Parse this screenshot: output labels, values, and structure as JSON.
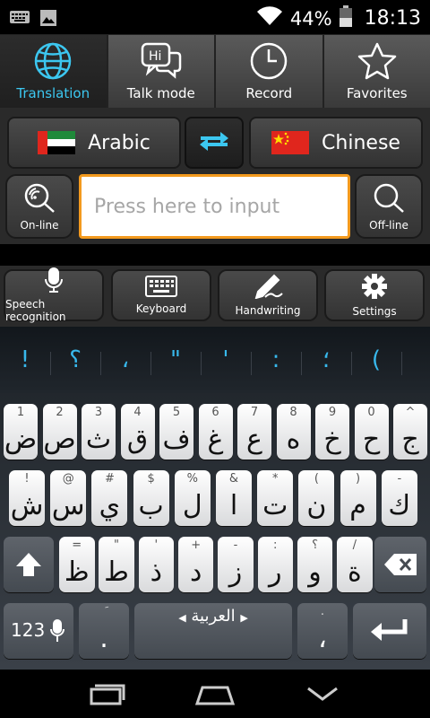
{
  "status_bar": {
    "battery": "44%",
    "time": "18:13",
    "icons": [
      "keyboard-icon",
      "image-icon",
      "wifi-icon",
      "battery-icon"
    ]
  },
  "tabs": [
    {
      "label": "Translation",
      "icon": "globe-icon",
      "active": true
    },
    {
      "label": "Talk mode",
      "icon": "chat-hi-icon",
      "bubble_text": "Hi",
      "active": false
    },
    {
      "label": "Record",
      "icon": "clock-icon",
      "active": false
    },
    {
      "label": "Favorites",
      "icon": "star-icon",
      "active": false
    }
  ],
  "languages": {
    "source": "Arabic",
    "target": "Chinese"
  },
  "search": {
    "online_label": "On-line",
    "offline_label": "Off-line",
    "placeholder": "Press here to input",
    "value": ""
  },
  "tools": [
    {
      "label": "Speech recognition",
      "icon": "microphone-icon"
    },
    {
      "label": "Keyboard",
      "icon": "keyboard-icon"
    },
    {
      "label": "Handwriting",
      "icon": "pen-icon"
    },
    {
      "label": "Settings",
      "icon": "gear-icon"
    }
  ],
  "suggestions": [
    "!",
    "؟",
    "،",
    "\"",
    "'",
    ":",
    "؛",
    "("
  ],
  "keyboard": {
    "row1": [
      {
        "main": "ض",
        "hint": "1"
      },
      {
        "main": "ص",
        "hint": "2"
      },
      {
        "main": "ث",
        "hint": "3"
      },
      {
        "main": "ق",
        "hint": "4"
      },
      {
        "main": "ف",
        "hint": "5"
      },
      {
        "main": "غ",
        "hint": "6"
      },
      {
        "main": "ع",
        "hint": "7"
      },
      {
        "main": "ه",
        "hint": "8"
      },
      {
        "main": "خ",
        "hint": "9"
      },
      {
        "main": "ح",
        "hint": "0"
      },
      {
        "main": "ج",
        "hint": "^"
      }
    ],
    "row2": [
      {
        "main": "ش",
        "hint": "!"
      },
      {
        "main": "س",
        "hint": "@"
      },
      {
        "main": "ي",
        "hint": "#"
      },
      {
        "main": "ب",
        "hint": "$"
      },
      {
        "main": "ل",
        "hint": "%"
      },
      {
        "main": "ا",
        "hint": "&"
      },
      {
        "main": "ت",
        "hint": "*"
      },
      {
        "main": "ن",
        "hint": "("
      },
      {
        "main": "م",
        "hint": ")"
      },
      {
        "main": "ك",
        "hint": "-"
      }
    ],
    "row3": [
      {
        "main": "ظ",
        "hint": "="
      },
      {
        "main": "ط",
        "hint": "\""
      },
      {
        "main": "ذ",
        "hint": "'"
      },
      {
        "main": "د",
        "hint": "+"
      },
      {
        "main": "ز",
        "hint": "-"
      },
      {
        "main": "ر",
        "hint": ":"
      },
      {
        "main": "و",
        "hint": "؟"
      },
      {
        "main": "ة",
        "hint": "/"
      }
    ],
    "numbers_key": "123",
    "period_key": ".",
    "period_hint": "َ",
    "space_label": "العربية",
    "comma_key": "،",
    "comma_hint": "."
  },
  "nav_icons": [
    "recent-apps-icon",
    "home-icon",
    "back-icon"
  ],
  "colors": {
    "accent": "#3cc7f0",
    "input_border": "#f39a1e"
  }
}
